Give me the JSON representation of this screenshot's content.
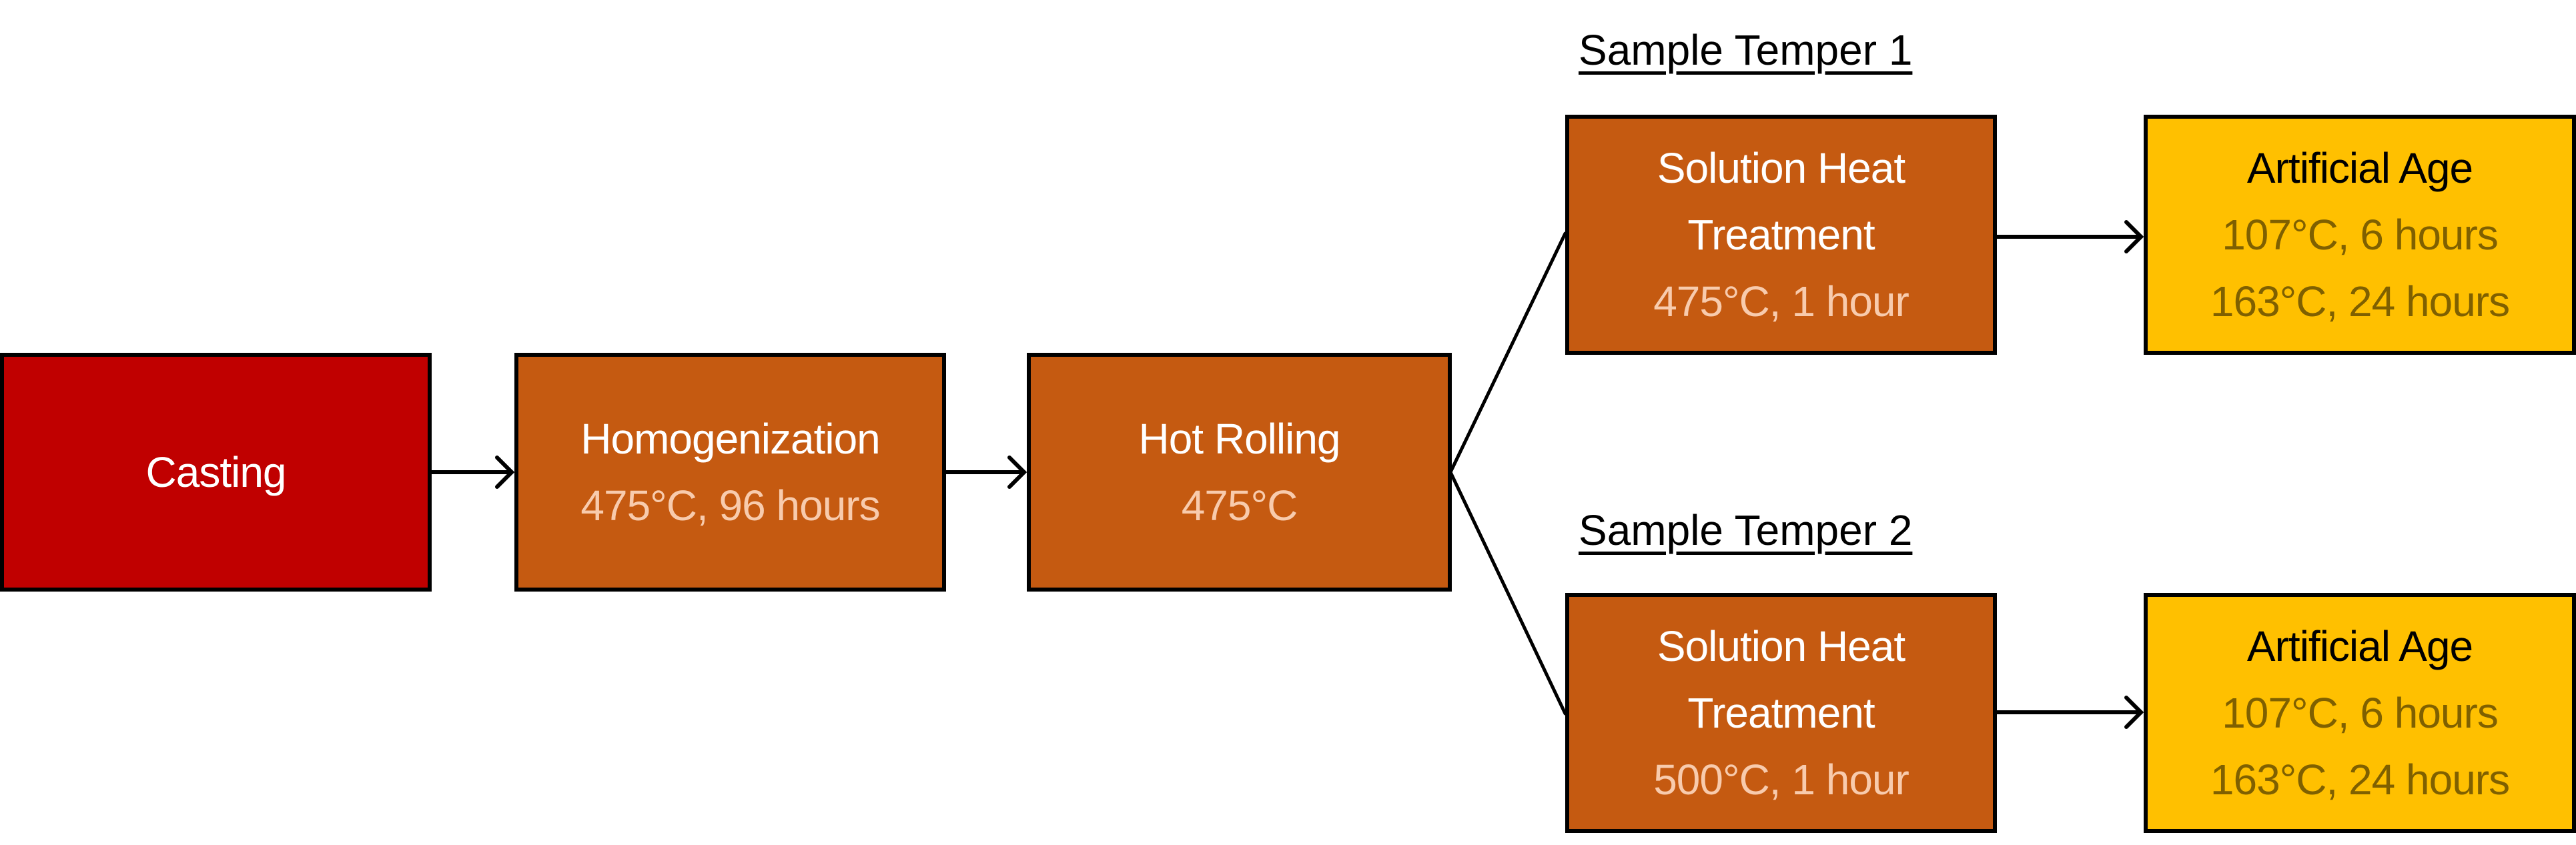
{
  "colors": {
    "casting": "#c00000",
    "process": "#c55a11",
    "process_detail": "#f8cbad",
    "aging": "#ffc000",
    "aging_detail": "#7f6000"
  },
  "casting": {
    "title": "Casting"
  },
  "homogenization": {
    "title": "Homogenization",
    "detail": "475°C, 96 hours"
  },
  "hot_rolling": {
    "title": "Hot Rolling",
    "detail": "475°C"
  },
  "temper1": {
    "label": "Sample Temper 1",
    "solution": {
      "title1": "Solution Heat",
      "title2": "Treatment",
      "detail": "475°C, 1 hour"
    },
    "age": {
      "title": "Artificial Age",
      "detail1": "107°C, 6 hours",
      "detail2": "163°C, 24 hours"
    }
  },
  "temper2": {
    "label": "Sample Temper 2",
    "solution": {
      "title1": "Solution Heat",
      "title2": "Treatment",
      "detail": "500°C, 1 hour"
    },
    "age": {
      "title": "Artificial Age",
      "detail1": "107°C, 6 hours",
      "detail2": "163°C, 24 hours"
    }
  }
}
